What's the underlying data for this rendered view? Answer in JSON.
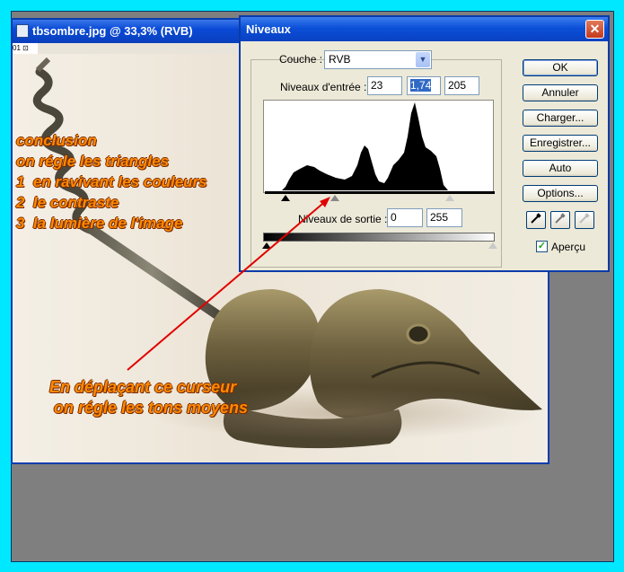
{
  "document": {
    "title": "tbsombre.jpg @ 33,3% (RVB)",
    "ruler_label": "01 ⊡"
  },
  "annotations": {
    "conclusion": "conclusion\non régle les triangles\n1  en ravivant les couleurs\n2  le contraste\n3  la lumière de l'image",
    "cursor_note": "En déplaçant ce curseur\n on régle les tons moyens"
  },
  "dialog": {
    "title": "Niveaux",
    "close_label": "✕",
    "channel_label": "Couche :",
    "channel_value": "RVB",
    "input_levels_label": "Niveaux d'entrée :",
    "input_black": "23",
    "input_gamma": "1,74",
    "input_white": "205",
    "output_levels_label": "Niveaux de sortie :",
    "output_black": "0",
    "output_white": "255",
    "buttons": {
      "ok": "OK",
      "cancel": "Annuler",
      "load": "Charger...",
      "save": "Enregistrer...",
      "auto": "Auto",
      "options": "Options..."
    },
    "preview_label": "Aperçu",
    "preview_checked": true
  },
  "colors": {
    "frame": "#00e8ff",
    "annotation": "#ff8a00",
    "arrow": "#e00000",
    "titlebar": "#0a4ad6"
  },
  "icons": [
    "photoshop-document-icon",
    "close-icon",
    "dropdown-arrow-icon",
    "black-eyedropper-icon",
    "gray-eyedropper-icon",
    "white-eyedropper-icon",
    "checkmark-icon"
  ]
}
